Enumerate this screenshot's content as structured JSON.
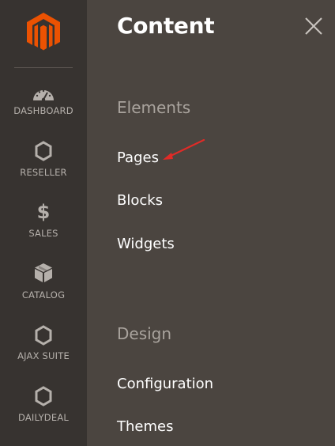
{
  "sidebar": {
    "logo_icon": "magento-logo-icon",
    "items": [
      {
        "label": "DASHBOARD",
        "icon": "dashboard-gauge-icon"
      },
      {
        "label": "RESELLER",
        "icon": "hexagon-icon"
      },
      {
        "label": "SALES",
        "icon": "dollar-icon",
        "glyph": "$"
      },
      {
        "label": "CATALOG",
        "icon": "cube-icon"
      },
      {
        "label": "AJAX SUITE",
        "icon": "hexagon-icon"
      },
      {
        "label": "DAILYDEAL",
        "icon": "hexagon-icon"
      }
    ]
  },
  "panel": {
    "title": "Content",
    "close_icon": "close-icon",
    "sections": [
      {
        "heading": "Elements",
        "links": [
          "Pages",
          "Blocks",
          "Widgets"
        ]
      },
      {
        "heading": "Design",
        "links": [
          "Configuration",
          "Themes"
        ]
      }
    ],
    "annotation_icon": "red-arrow-icon"
  },
  "colors": {
    "sidebar_bg": "#373330",
    "panel_bg": "#4b4540",
    "logo": "#eb5202",
    "section_heading": "#a9a39d",
    "link": "#ffffff",
    "annotation": "#e02b27"
  }
}
